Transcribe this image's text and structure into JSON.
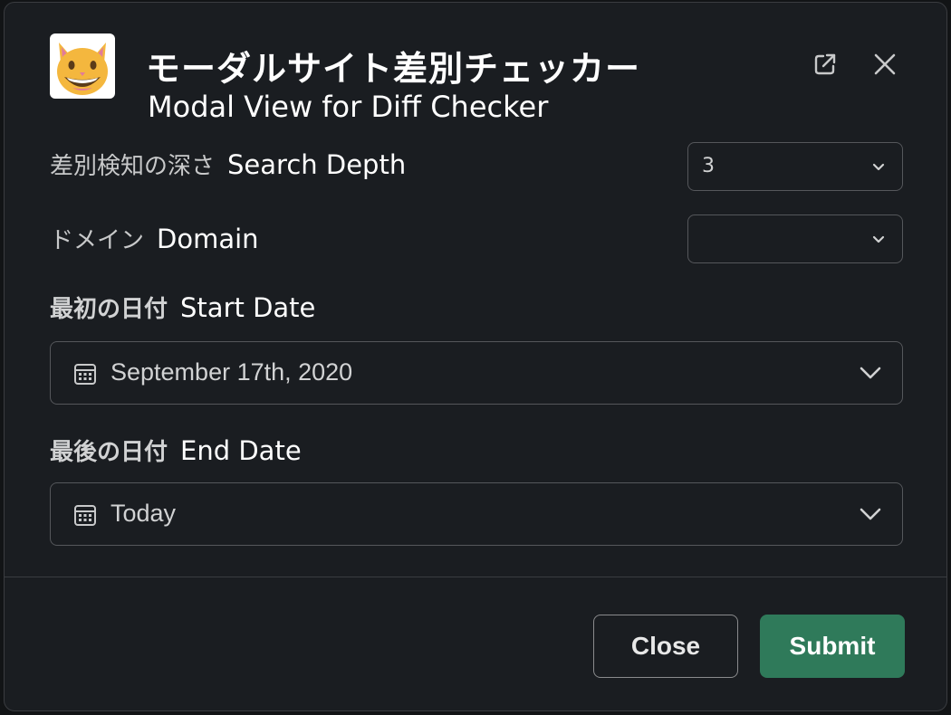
{
  "modal": {
    "title_ja": "モーダルサイト差別チェッカー",
    "title_en": "Modal View for Diff Checker",
    "app_icon": "grinning-cat-emoji-icon",
    "header_actions": [
      "external-link-icon",
      "close-icon"
    ]
  },
  "fields": {
    "search_depth": {
      "label_ja": "差別検知の深さ",
      "label_en": "Search Depth",
      "value": "3"
    },
    "domain": {
      "label_ja": "ドメイン",
      "label_en": "Domain",
      "value": ""
    },
    "start_date": {
      "label_ja": "最初の日付",
      "label_en": "Start Date",
      "value": "September 17th, 2020"
    },
    "end_date": {
      "label_ja": "最後の日付",
      "label_en": "End Date",
      "value": "Today"
    }
  },
  "footer": {
    "close_label": "Close",
    "submit_label": "Submit"
  },
  "colors": {
    "background": "#1a1d21",
    "border": "#55575b",
    "submit": "#2f7a5a",
    "text": "#d1d2d3"
  }
}
